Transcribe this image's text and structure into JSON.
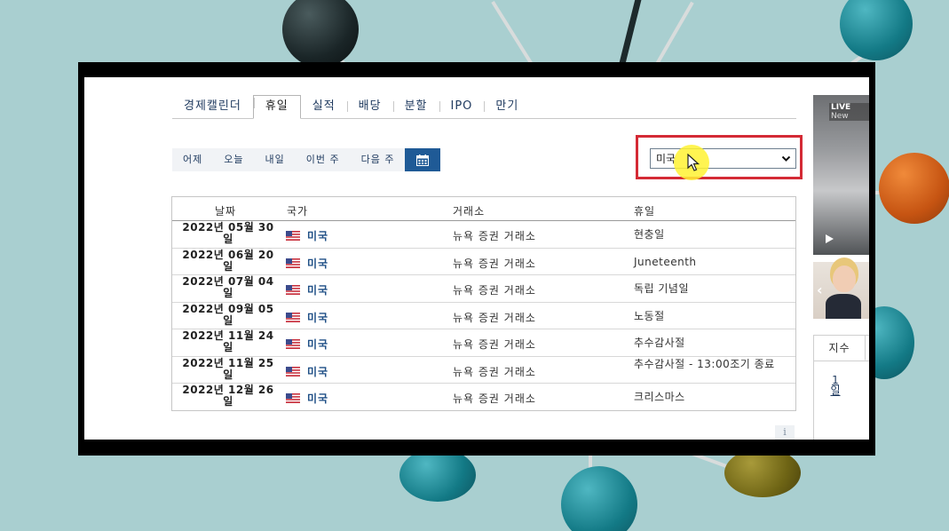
{
  "tabs": [
    {
      "label": "경제캘린더",
      "active": false
    },
    {
      "label": "휴일",
      "active": true
    },
    {
      "label": "실적",
      "active": false
    },
    {
      "label": "배당",
      "active": false
    },
    {
      "label": "분할",
      "active": false
    },
    {
      "label": "IPO",
      "active": false
    },
    {
      "label": "만기",
      "active": false
    }
  ],
  "day_filter": {
    "yesterday": "어제",
    "today": "오늘",
    "tomorrow": "내일",
    "this_week": "이번 주",
    "next_week": "다음 주",
    "calendar_icon": "calendar-icon"
  },
  "country_select": {
    "value": "미국"
  },
  "table": {
    "headers": {
      "date": "날짜",
      "country": "국가",
      "exchange": "거래소",
      "holiday": "휴일"
    },
    "rows": [
      {
        "date": "2022년 05월 30일",
        "country": "미국",
        "exchange": "뉴욕 증권 거래소",
        "holiday": "현충일"
      },
      {
        "date": "2022년 06월 20일",
        "country": "미국",
        "exchange": "뉴욕 증권 거래소",
        "holiday": "Juneteenth"
      },
      {
        "date": "2022년 07월 04일",
        "country": "미국",
        "exchange": "뉴욕 증권 거래소",
        "holiday": "독립 기념일"
      },
      {
        "date": "2022년 09월 05일",
        "country": "미국",
        "exchange": "뉴욕 증권 거래소",
        "holiday": "노동절"
      },
      {
        "date": "2022년 11월 24일",
        "country": "미국",
        "exchange": "뉴욕 증권 거래소",
        "holiday": "추수감사절"
      },
      {
        "date": "2022년 11월 25일",
        "country": "미국",
        "exchange": "뉴욕 증권 거래소",
        "holiday": "추수감사절 - 13:00조기 종료"
      },
      {
        "date": "2022년 12월 26일",
        "country": "미국",
        "exchange": "뉴욕 증권 거래소",
        "holiday": "크리스마스"
      }
    ]
  },
  "side": {
    "live_badge": "LIVE",
    "live_suffix": "New",
    "widget_tab": "지수",
    "period_link": "1일"
  },
  "colors": {
    "accent": "#1f5a96",
    "highlight_box": "#d42a35",
    "cursor_glow": "#fff232",
    "link": "#1f4f86"
  }
}
